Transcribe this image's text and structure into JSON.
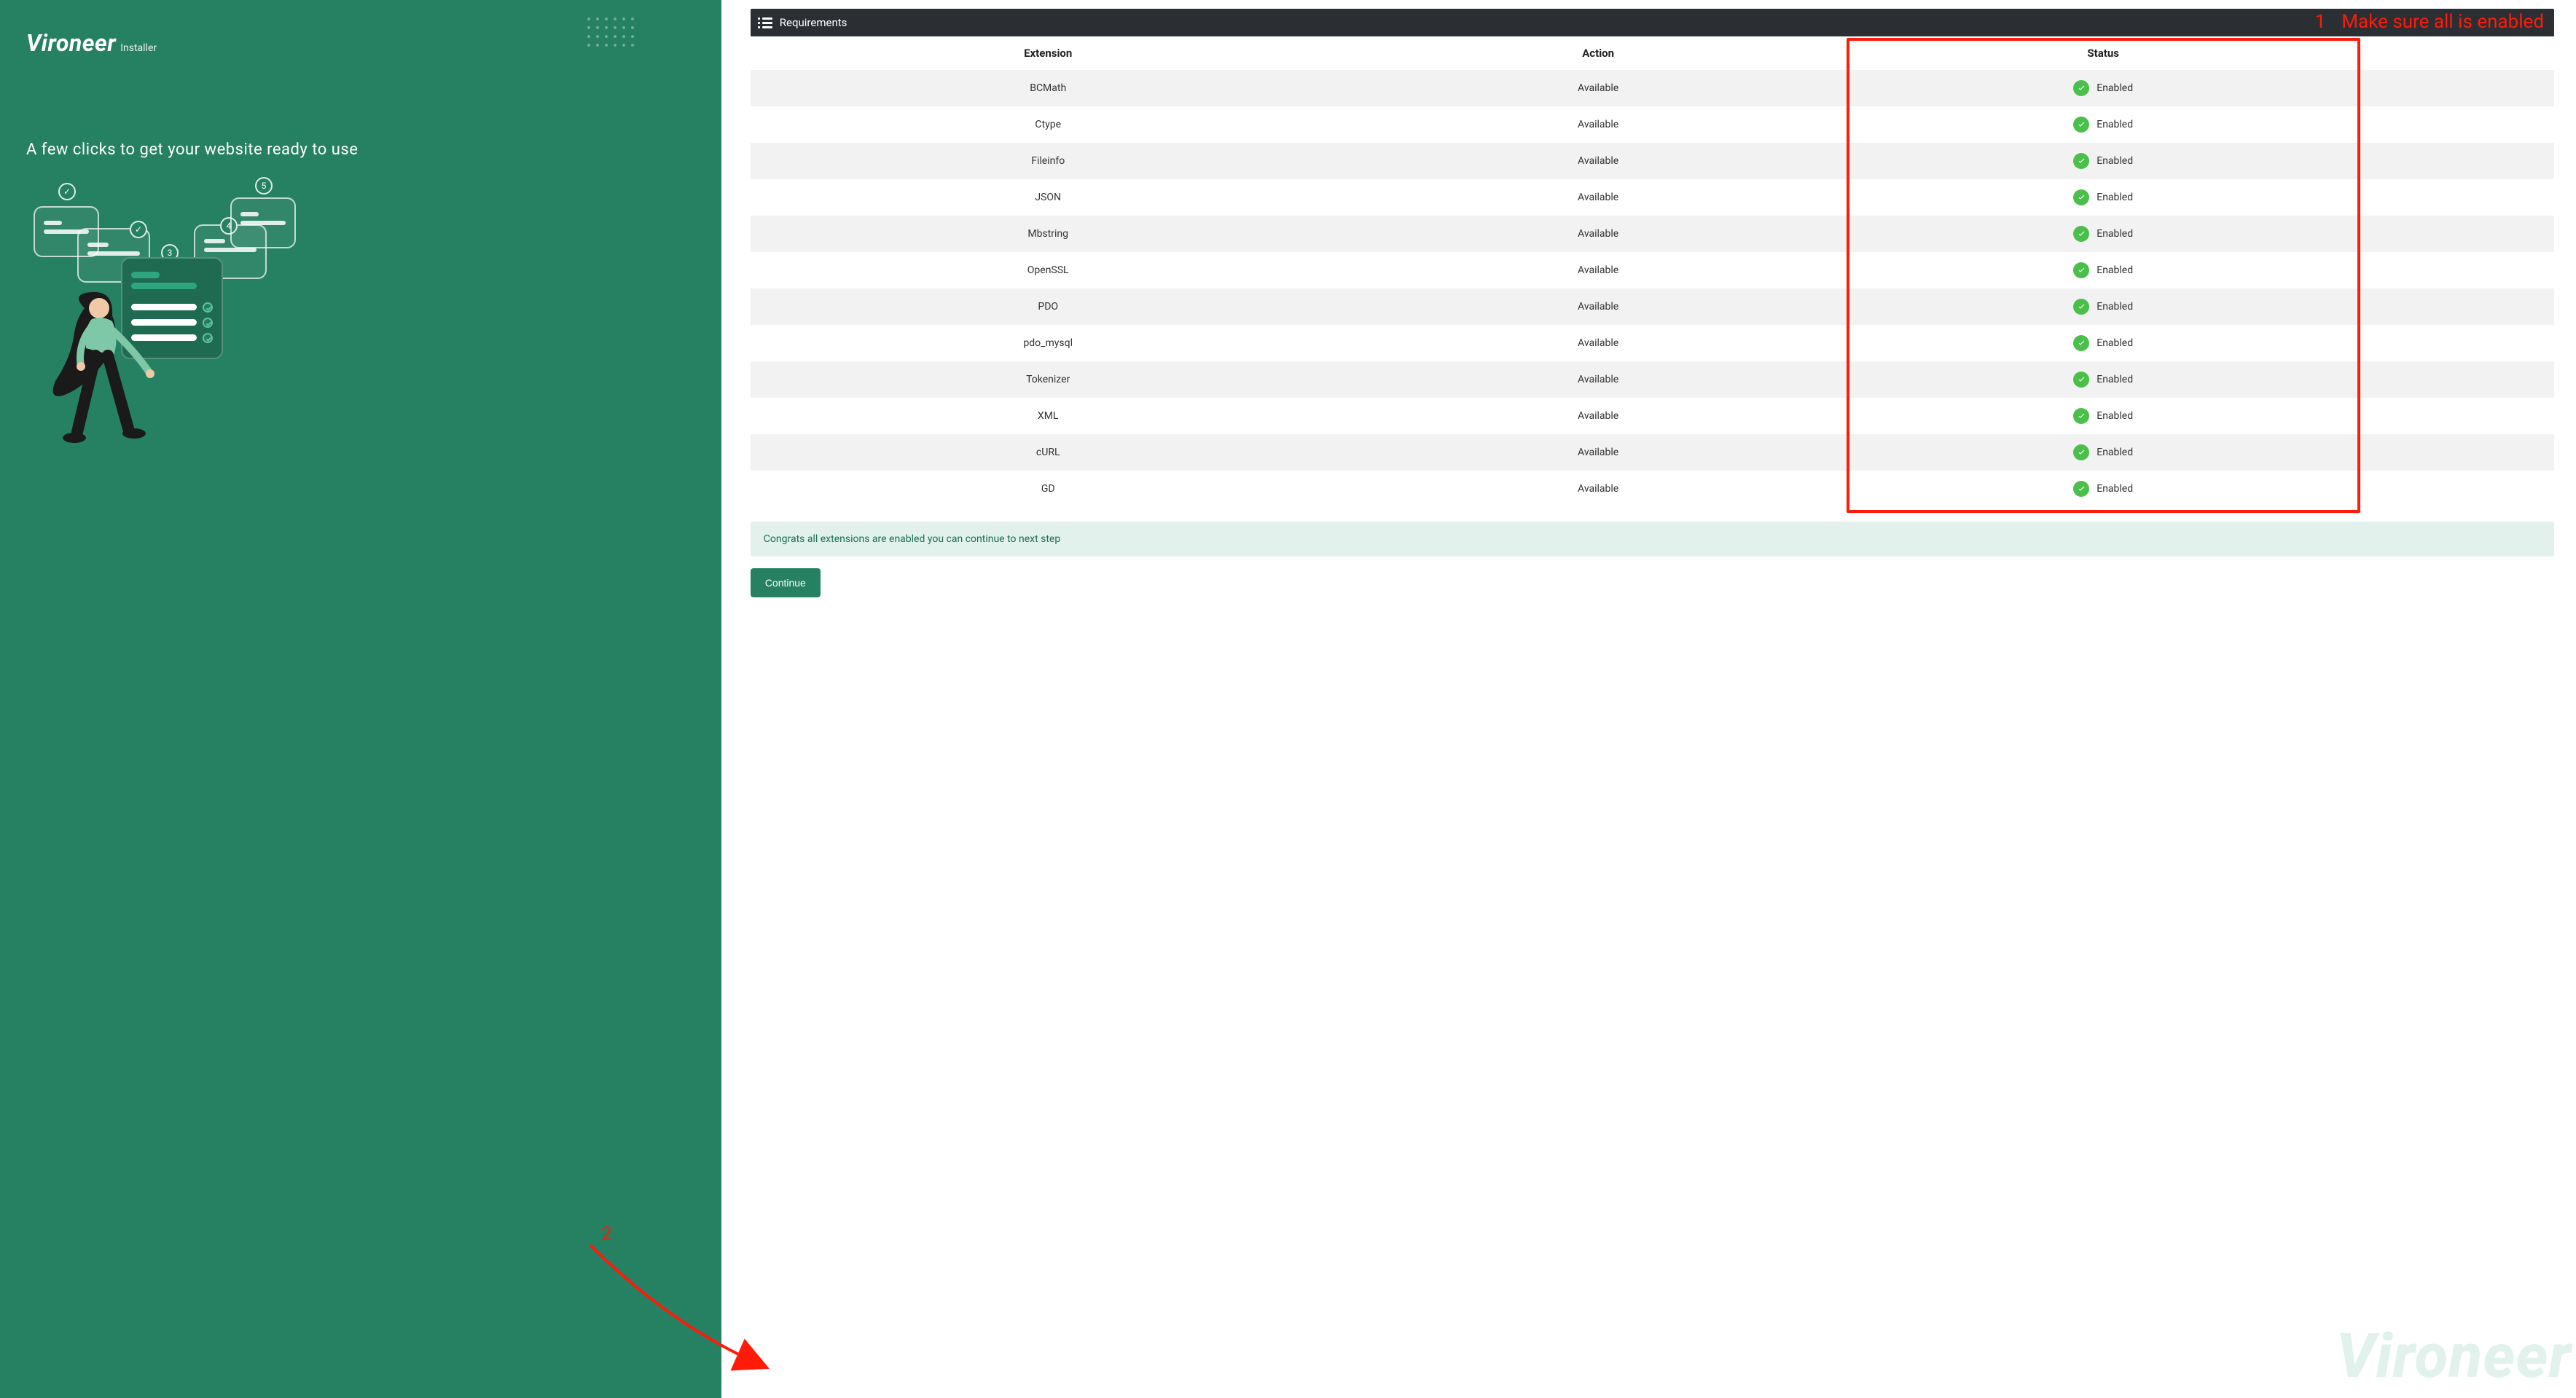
{
  "brand": {
    "name": "Vironeer",
    "suffix": "Installer"
  },
  "sidebar": {
    "tagline": "A few clicks to get your website ready to use",
    "steps": [
      "✓",
      "✓",
      "3",
      "4",
      "5"
    ]
  },
  "panel": {
    "title": "Requirements"
  },
  "annotations": {
    "one_number": "1",
    "one_text": "Make sure all is enabled",
    "two_number": "2"
  },
  "table": {
    "headers": [
      "Extension",
      "Action",
      "Status"
    ],
    "rows": [
      {
        "extension": "BCMath",
        "action": "Available",
        "status": "Enabled"
      },
      {
        "extension": "Ctype",
        "action": "Available",
        "status": "Enabled"
      },
      {
        "extension": "Fileinfo",
        "action": "Available",
        "status": "Enabled"
      },
      {
        "extension": "JSON",
        "action": "Available",
        "status": "Enabled"
      },
      {
        "extension": "Mbstring",
        "action": "Available",
        "status": "Enabled"
      },
      {
        "extension": "OpenSSL",
        "action": "Available",
        "status": "Enabled"
      },
      {
        "extension": "PDO",
        "action": "Available",
        "status": "Enabled"
      },
      {
        "extension": "pdo_mysql",
        "action": "Available",
        "status": "Enabled"
      },
      {
        "extension": "Tokenizer",
        "action": "Available",
        "status": "Enabled"
      },
      {
        "extension": "XML",
        "action": "Available",
        "status": "Enabled"
      },
      {
        "extension": "cURL",
        "action": "Available",
        "status": "Enabled"
      },
      {
        "extension": "GD",
        "action": "Available",
        "status": "Enabled"
      }
    ]
  },
  "alert": {
    "message": "Congrats all extensions are enabled you can continue to next step"
  },
  "actions": {
    "continue": "Continue"
  },
  "watermark": "Vironeer"
}
